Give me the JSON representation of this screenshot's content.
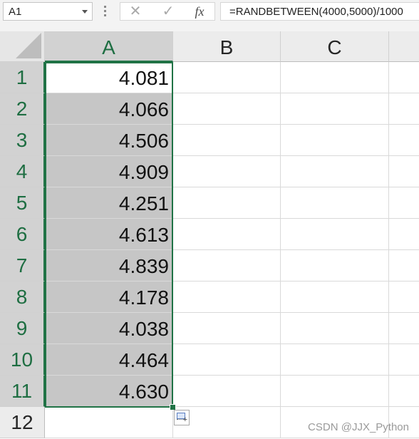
{
  "formula_bar": {
    "name_box": "A1",
    "cancel_icon": "✕",
    "enter_icon": "✓",
    "function_icon": "fx",
    "formula": "=RANDBETWEEN(4000,5000)/1000"
  },
  "columns": [
    "A",
    "B",
    "C"
  ],
  "rows": [
    {
      "num": "1",
      "a": "4.081"
    },
    {
      "num": "2",
      "a": "4.066"
    },
    {
      "num": "3",
      "a": "4.506"
    },
    {
      "num": "4",
      "a": "4.909"
    },
    {
      "num": "5",
      "a": "4.251"
    },
    {
      "num": "6",
      "a": "4.613"
    },
    {
      "num": "7",
      "a": "4.839"
    },
    {
      "num": "8",
      "a": "4.178"
    },
    {
      "num": "9",
      "a": "4.038"
    },
    {
      "num": "10",
      "a": "4.464"
    },
    {
      "num": "11",
      "a": "4.630"
    },
    {
      "num": "12",
      "a": ""
    }
  ],
  "selection": "A1:A11",
  "watermark": "CSDN @JJX_Python",
  "colors": {
    "accent": "#217346",
    "selected_fill": "#c6c6c6"
  }
}
